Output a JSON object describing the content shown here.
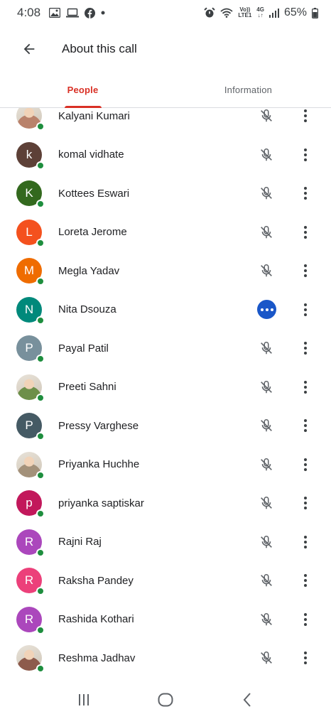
{
  "status_bar": {
    "time": "4:08",
    "net_top": "Vo))",
    "net_bottom": "LTE1",
    "gen_top": "4G",
    "gen_bottom": "↓↑",
    "battery": "65%"
  },
  "app_bar": {
    "title": "About this call"
  },
  "tabs": {
    "people": "People",
    "information": "Information"
  },
  "participants": [
    {
      "name": "Kalyani Kumari",
      "initial": "",
      "avatar_color": "#b9826b",
      "photo": true,
      "status": "muted"
    },
    {
      "name": "komal vidhate",
      "initial": "k",
      "avatar_color": "#5d4037",
      "photo": false,
      "status": "muted"
    },
    {
      "name": "Kottees Eswari",
      "initial": "K",
      "avatar_color": "#33691e",
      "photo": false,
      "status": "muted"
    },
    {
      "name": "Loreta Jerome",
      "initial": "L",
      "avatar_color": "#f4511e",
      "photo": false,
      "status": "muted"
    },
    {
      "name": "Megla Yadav",
      "initial": "M",
      "avatar_color": "#ef6c00",
      "photo": false,
      "status": "muted"
    },
    {
      "name": "Nita Dsouza",
      "initial": "N",
      "avatar_color": "#00897b",
      "photo": false,
      "status": "speaking"
    },
    {
      "name": "Payal Patil",
      "initial": "P",
      "avatar_color": "#78909c",
      "photo": false,
      "status": "muted"
    },
    {
      "name": "Preeti Sahni",
      "initial": "",
      "avatar_color": "#6d8f4a",
      "photo": true,
      "status": "muted"
    },
    {
      "name": "Pressy Varghese",
      "initial": "P",
      "avatar_color": "#455a64",
      "photo": false,
      "status": "muted"
    },
    {
      "name": "Priyanka Huchhe",
      "initial": "",
      "avatar_color": "#a3917a",
      "photo": true,
      "status": "muted"
    },
    {
      "name": "priyanka saptiskar",
      "initial": "p",
      "avatar_color": "#c2185b",
      "photo": false,
      "status": "muted"
    },
    {
      "name": "Rajni Raj",
      "initial": "R",
      "avatar_color": "#ab47bc",
      "photo": false,
      "status": "muted"
    },
    {
      "name": "Raksha Pandey",
      "initial": "R",
      "avatar_color": "#ec407a",
      "photo": false,
      "status": "muted"
    },
    {
      "name": "Rashida Kothari",
      "initial": "R",
      "avatar_color": "#ab47bc",
      "photo": false,
      "status": "muted"
    },
    {
      "name": "Reshma Jadhav",
      "initial": "",
      "avatar_color": "#8d5b4c",
      "photo": true,
      "status": "muted"
    }
  ],
  "colors": {
    "accent": "#d93025",
    "presence": "#1e8e3e",
    "speaking": "#1a57c8"
  },
  "icons": {
    "back": "arrow-back-icon",
    "mic_off": "mic-off-icon",
    "speaking": "speaking-dots-icon",
    "more": "more-vert-icon",
    "nav_recents": "recents-icon",
    "nav_home": "home-icon",
    "nav_back": "nav-back-icon"
  }
}
